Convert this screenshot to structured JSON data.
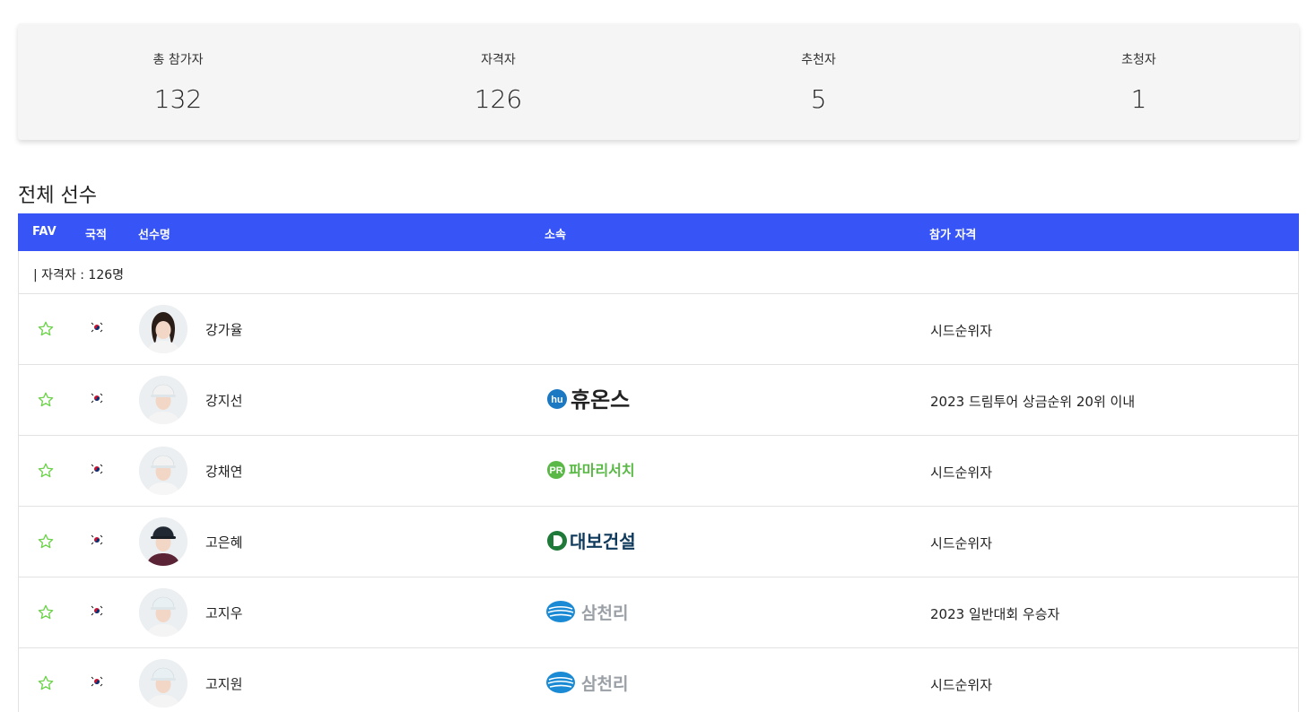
{
  "stats": [
    {
      "label": "총 참가자",
      "value": "132"
    },
    {
      "label": "자격자",
      "value": "126"
    },
    {
      "label": "추천자",
      "value": "5"
    },
    {
      "label": "초청자",
      "value": "1"
    }
  ],
  "section_title": "전체 선수",
  "table": {
    "headers": {
      "fav": "FAV",
      "nation": "국적",
      "name": "선수명",
      "team": "소속",
      "qualification": "참가 자격"
    },
    "group_label": "| 자격자 : 126명",
    "rows": [
      {
        "name": "강가율",
        "sponsor": "",
        "qualification": "시드순위자"
      },
      {
        "name": "강지선",
        "sponsor": "휴온스",
        "qualification": "2023 드림투어 상금순위 20위 이내"
      },
      {
        "name": "강채연",
        "sponsor": "파마리서치",
        "qualification": "시드순위자"
      },
      {
        "name": "고은혜",
        "sponsor": "대보건설",
        "qualification": "시드순위자"
      },
      {
        "name": "고지우",
        "sponsor": "삼천리",
        "qualification": "2023 일반대회 우승자"
      },
      {
        "name": "고지원",
        "sponsor": "삼천리",
        "qualification": "시드순위자"
      }
    ]
  },
  "colors": {
    "header_bg": "#3755f6",
    "star": "#6cd24a",
    "huons": "#1b79c4",
    "pharma": "#5ab946",
    "daebo": "#0f3a5c",
    "samchully": "#1a8ad4"
  },
  "icons": {
    "fav": "star-outline-icon",
    "flag": "korea-flag-icon",
    "avatar": "player-photo"
  }
}
